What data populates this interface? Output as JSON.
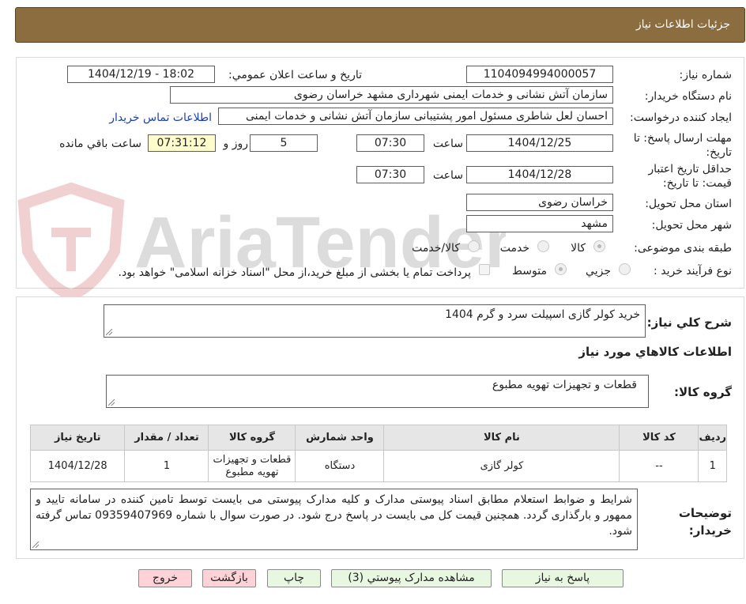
{
  "header": {
    "title": "جزئیات اطلاعات نیاز"
  },
  "watermark": {
    "text": "AriaTender.neT"
  },
  "labels": {
    "need_number": "شماره نیاز:",
    "announce_datetime": "تاریخ و ساعت اعلان عمومي:",
    "buyer_org": "نام دستگاه خریدار:",
    "requester": "ایجاد کننده درخواست:",
    "contact_link": "اطلاعات تماس خریدار",
    "reply_deadline": "مهلت ارسال پاسخ: تا تاریخ:",
    "time_word": "ساعت",
    "days_and": "روز و",
    "remaining": "ساعت باقي مانده",
    "price_validity": "حداقل تاریخ اعتبار قیمت: تا تاریخ:",
    "province": "استان محل تحویل:",
    "city": "شهر محل تحویل:",
    "category": "طبقه بندی موضوعی:",
    "purchase_type": "نوع فرآیند خرید :"
  },
  "values": {
    "need_number": "1104094994000057",
    "announce_datetime": "1404/12/19 - 18:02",
    "buyer_org": "سازمان آتش نشانی و خدمات ایمنی شهرداری مشهد خراسان رضوی",
    "requester": "احسان لعل شاطری مسئول امور پشتیبانی سازمان آتش نشانی و خدمات ایمنی",
    "reply_date": "1404/12/25",
    "reply_time": "07:30",
    "days": "5",
    "remaining_time": "07:31:12",
    "validity_date": "1404/12/28",
    "validity_time": "07:30",
    "province": "خراسان رضوی",
    "city": "مشهد"
  },
  "category_options": [
    {
      "label": "کالا",
      "selected": true
    },
    {
      "label": "خدمت",
      "selected": false
    },
    {
      "label": "کالا/خدمت",
      "selected": false
    }
  ],
  "purchase_options": [
    {
      "label": "جزیي",
      "selected": false
    },
    {
      "label": "متوسط",
      "selected": true
    }
  ],
  "payment_note": "پرداخت تمام یا بخشی از مبلغ خرید،از محل \"اسناد خزانه اسلامی\" خواهد بود.",
  "summary": {
    "label": "شرح کلي نیاز:",
    "value": "خرید کولر گازی اسپیلت سرد و گرم 1404",
    "goods_info_title": "اطلاعات کالاهاي مورد نیاز",
    "goods_group_label": "گروه کالا:",
    "goods_group_value": "قطعات و تجهیزات تهویه مطبوع"
  },
  "table": {
    "headers": [
      "ردیف",
      "کد کالا",
      "نام کالا",
      "واحد شمارش",
      "گروه کالا",
      "تعداد / مقدار",
      "تاریخ نیاز"
    ],
    "rows": [
      [
        "1",
        "--",
        "کولر گازی",
        "دستگاه",
        "قطعات و تجهیزات تهویه مطبوع",
        "1",
        "1404/12/28"
      ]
    ]
  },
  "buyer_notes": {
    "label": "توضیحات خریدار:",
    "text": "شرایط و ضوابط استعلام مطابق اسناد پیوستی مدارک و کلیه مدارک پیوستی می بایست توسط تامین کننده در سامانه تایید و ممهور و بارگذاری گردد. همچنین قیمت کل می بایست در پاسخ درج شود. در صورت سوال با شماره 09359407969 تماس گرفته شود."
  },
  "buttons": {
    "reply": "پاسخ به نیاز",
    "view_docs": "مشاهده مدارک پیوستي (3)",
    "print": "چاپ",
    "back": "بازگشت",
    "exit": "خروج"
  },
  "colors": {
    "header_bg": "#8b6d3f",
    "button_green": "#e8f8e0",
    "button_pink": "#ffd2d8",
    "link": "#1a3fb3",
    "highlight": "#fffccc"
  }
}
